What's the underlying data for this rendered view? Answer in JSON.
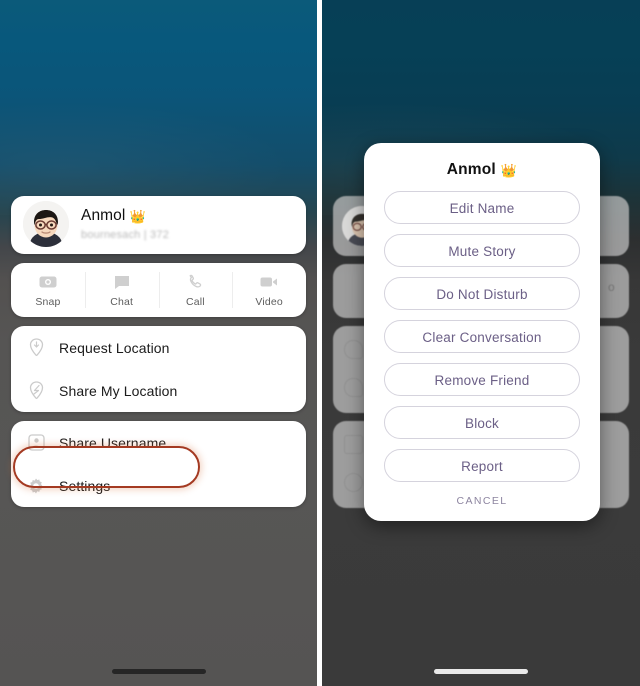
{
  "meta": {
    "accent_highlight": "#a43a22",
    "modal_text_color": "#6b5f86",
    "card_bg": "#ffffff"
  },
  "left_panel": {
    "profile": {
      "name": "Anmol",
      "name_emoji": "👑",
      "username_line": "bournesach | 372",
      "avatar_icon": "bitmoji-avatar"
    },
    "quick_actions": [
      {
        "label": "Snap",
        "icon": "camera-icon"
      },
      {
        "label": "Chat",
        "icon": "chat-bubble-icon"
      },
      {
        "label": "Call",
        "icon": "phone-icon"
      },
      {
        "label": "Video",
        "icon": "video-camera-icon"
      }
    ],
    "location_group": [
      {
        "label": "Request Location",
        "icon": "location-pin-down-icon"
      },
      {
        "label": "Share My Location",
        "icon": "location-pin-icon"
      }
    ],
    "settings_group": [
      {
        "label": "Share Username",
        "icon": "contact-card-icon"
      },
      {
        "label": "Settings",
        "icon": "gear-icon",
        "highlighted": true
      }
    ]
  },
  "right_panel": {
    "modal": {
      "title": "Anmol",
      "title_emoji": "👑",
      "options": [
        {
          "label": "Edit Name"
        },
        {
          "label": "Mute Story"
        },
        {
          "label": "Do Not Disturb"
        },
        {
          "label": "Clear Conversation"
        },
        {
          "label": "Remove Friend",
          "highlighted": true
        },
        {
          "label": "Block"
        },
        {
          "label": "Report"
        }
      ],
      "cancel_label": "CANCEL"
    }
  }
}
